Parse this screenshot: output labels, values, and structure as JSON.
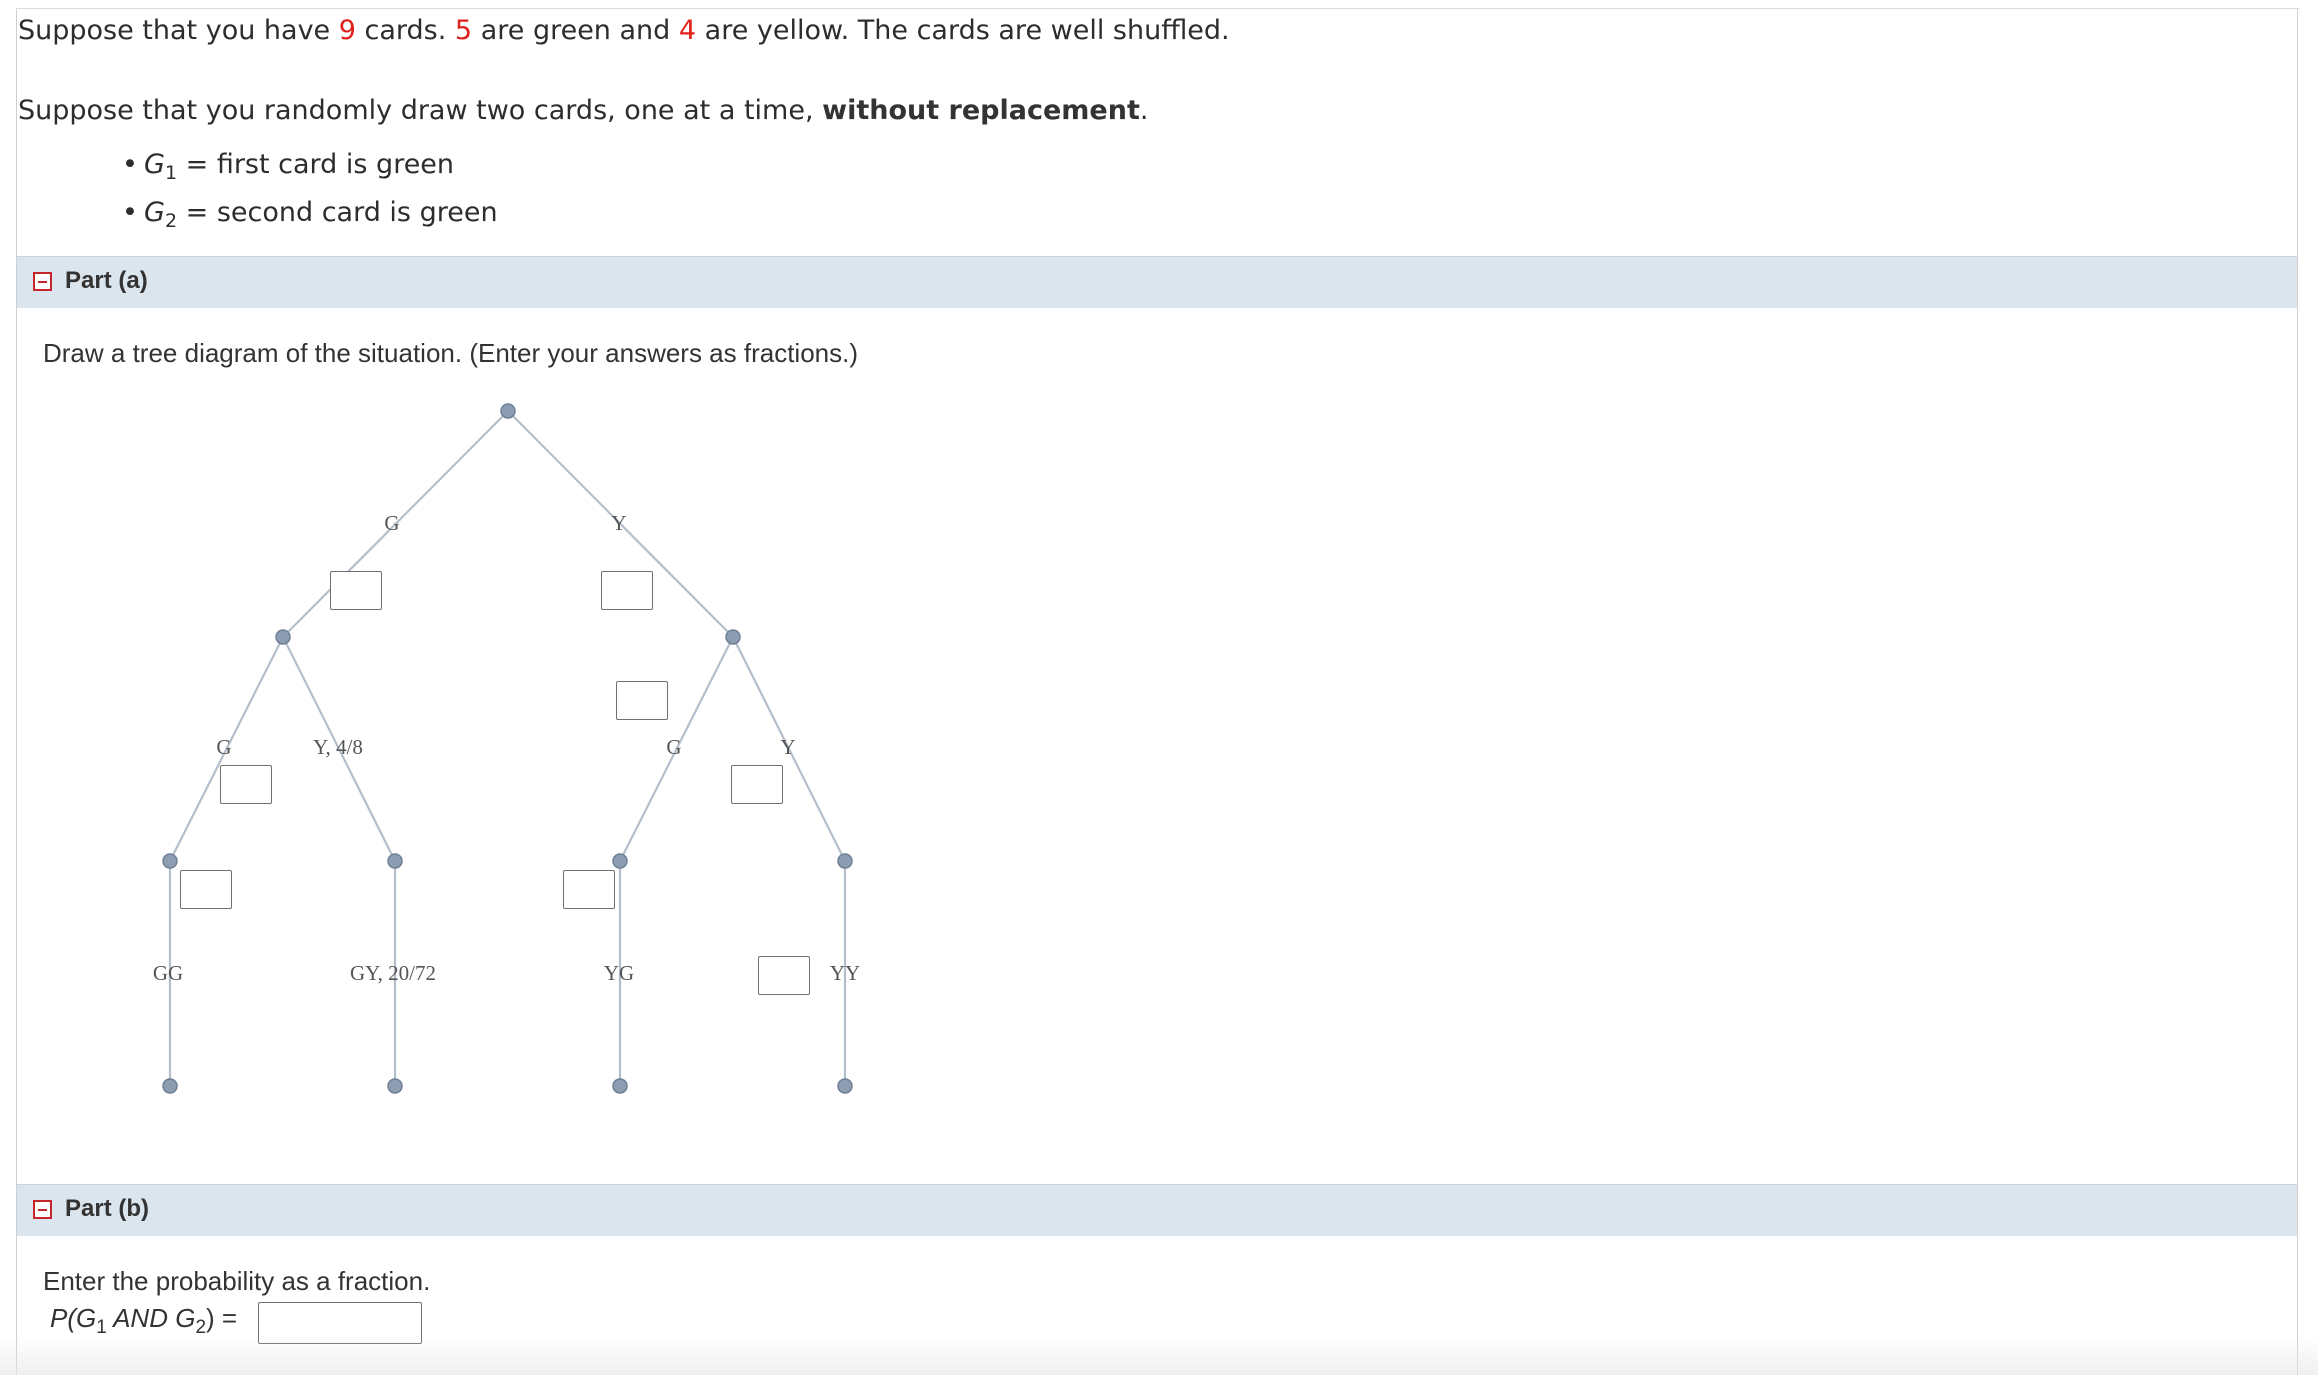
{
  "problem": {
    "sentence1": {
      "pre": "Suppose that you have ",
      "total": "9",
      "mid1": " cards. ",
      "green_count": "5",
      "mid2": " are green and ",
      "yellow_count": "4",
      "post": " are yellow. The cards are well shuffled."
    },
    "sentence2": {
      "pre": "Suppose that you randomly draw two cards, one at a time, ",
      "bold": "without replacement",
      "post": "."
    },
    "events": [
      {
        "var": "G",
        "sub": "1",
        "text": " = first card is green"
      },
      {
        "var": "G",
        "sub": "2",
        "text": " = second card is green"
      }
    ]
  },
  "part_a": {
    "label": "Part (a)",
    "instruction": "Draw a tree diagram of the situation. (Enter your answers as fractions.)",
    "tree_labels": {
      "first_green": "G",
      "first_yellow": "Y",
      "g_then_green": "G",
      "g_then_yellow": "Y, 4/8",
      "y_then_green": "G",
      "y_then_yellow": "Y",
      "outcome_gg": "GG",
      "outcome_gy": "GY, 20/72",
      "outcome_yg": "YG",
      "outcome_yy": "YY"
    }
  },
  "part_b": {
    "label": "Part (b)",
    "instruction": "Enter the probability as a fraction.",
    "formula": {
      "p": "P(",
      "v1": "G",
      "s1": "1",
      "and": " AND ",
      "v2": "G",
      "s2": "2",
      "close": ") ="
    }
  },
  "colors": {
    "accent_red": "#e0201b",
    "header_bg": "#dbe5ee",
    "line": "#b4bfcc",
    "node": "#8e9db1"
  }
}
